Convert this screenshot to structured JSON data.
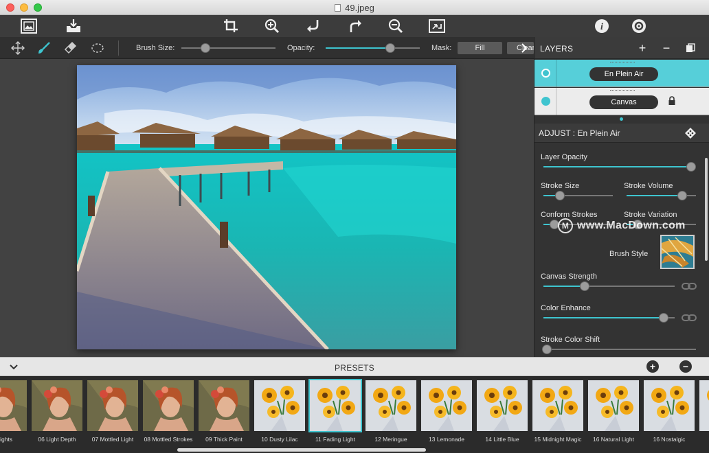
{
  "window": {
    "title": "49.jpeg"
  },
  "toolbar": {
    "buttons": [
      "open-image-icon",
      "export-icon",
      "crop-icon",
      "zoom-in-icon",
      "undo-icon",
      "redo-icon",
      "zoom-out-icon",
      "fit-screen-icon",
      "info-icon",
      "settings-icon"
    ]
  },
  "options": {
    "tools": [
      "move-icon",
      "brush-icon",
      "eraser-icon",
      "lasso-icon"
    ],
    "brush_size_label": "Brush Size:",
    "brush_size_value": 0.23,
    "opacity_label": "Opacity:",
    "opacity_value": 0.71,
    "mask_label": "Mask:",
    "fill_label": "Fill",
    "clear_label": "Clear"
  },
  "layers": {
    "title": "LAYERS",
    "add": "+",
    "remove": "−",
    "items": [
      {
        "name": "En Plein Air",
        "selected": true
      },
      {
        "name": "Canvas",
        "selected": false,
        "locked": true
      }
    ]
  },
  "adjust": {
    "title": "ADJUST : En Plein Air",
    "layer_opacity": {
      "label": "Layer Opacity",
      "value": 1.0
    },
    "stroke_size": {
      "label": "Stroke Size",
      "value": 0.2
    },
    "stroke_volume": {
      "label": "Stroke Volume",
      "value": 0.85
    },
    "conform_strokes": {
      "label": "Conform Strokes",
      "value": 0.1
    },
    "stroke_variation": {
      "label": "Stroke Variation",
      "value": 0.1
    },
    "brush_style": {
      "label": "Brush Style"
    },
    "canvas_strength": {
      "label": "Canvas Strength",
      "value": 0.3
    },
    "color_enhance": {
      "label": "Color Enhance",
      "value": 0.95
    },
    "stroke_color_shift": {
      "label": "Stroke Color Shift",
      "value": 0.0
    }
  },
  "watermark": {
    "text": "www.MacDown.com"
  },
  "presets": {
    "title": "PRESETS",
    "add": "+",
    "remove": "−",
    "items": [
      {
        "label": "ry Lights",
        "kind": "portrait"
      },
      {
        "label": "06 Light Depth",
        "kind": "portrait"
      },
      {
        "label": "07 Mottled Light",
        "kind": "portrait"
      },
      {
        "label": "08 Mottled Strokes",
        "kind": "portrait"
      },
      {
        "label": "09 Thick Paint",
        "kind": "portrait"
      },
      {
        "label": "10 Dusty Lilac",
        "kind": "flowers"
      },
      {
        "label": "11 Fading Light",
        "kind": "flowers",
        "selected": true
      },
      {
        "label": "12 Meringue",
        "kind": "flowers"
      },
      {
        "label": "13 Lemonade",
        "kind": "flowers"
      },
      {
        "label": "14 Little Blue",
        "kind": "flowers"
      },
      {
        "label": "15 Midnight Magic",
        "kind": "flowers"
      },
      {
        "label": "16 Natural Light",
        "kind": "flowers"
      },
      {
        "label": "16 Nostalgic",
        "kind": "flowers"
      },
      {
        "label": "",
        "kind": "flowers"
      }
    ]
  },
  "colors": {
    "accent": "#3ec5d0",
    "selected_layer": "#56cfd9"
  }
}
